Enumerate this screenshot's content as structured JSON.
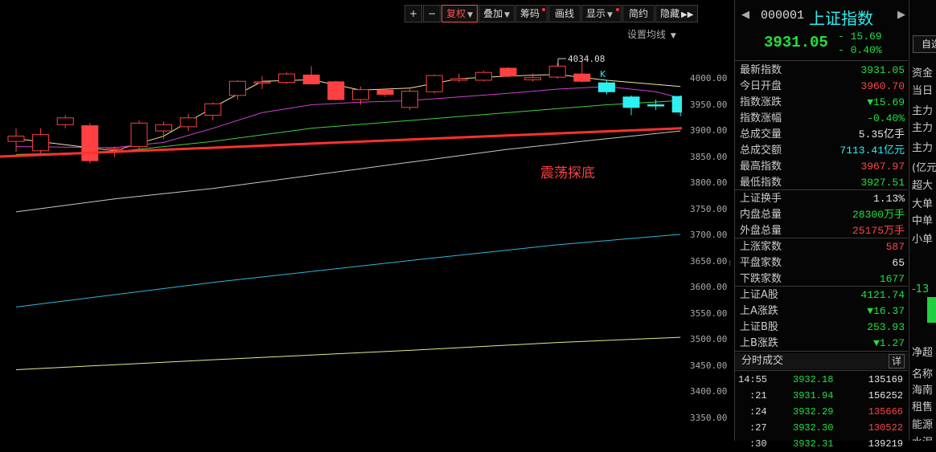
{
  "toolbar": {
    "plus": "+",
    "minus": "−",
    "fuquan": "复权",
    "diejia": "叠加",
    "chouma": "筹码",
    "huaxian": "画线",
    "xianshi": "显示",
    "jianyue": "简约",
    "yincang": "隐藏"
  },
  "chart": {
    "ma_setting": "设置均线",
    "high_marker": "4034.08",
    "k_label": "K",
    "annotation": "震荡探底"
  },
  "chart_data": {
    "type": "candlestick",
    "y_ticks": [
      "4000.00",
      "3950.00",
      "3900.00",
      "3850.00",
      "3800.00",
      "3750.00",
      "3700.00",
      "3650.00",
      "3600.00",
      "3550.00",
      "3500.00",
      "3450.00",
      "3400.00",
      "3350.00"
    ],
    "ylim": [
      3330,
      4060
    ],
    "candles": [
      {
        "o": 3890,
        "h": 3905,
        "l": 3860,
        "c": 3880,
        "dir": "up"
      },
      {
        "o": 3862,
        "h": 3905,
        "l": 3855,
        "c": 3893,
        "dir": "up"
      },
      {
        "o": 3912,
        "h": 3930,
        "l": 3905,
        "c": 3925,
        "dir": "up"
      },
      {
        "o": 3910,
        "h": 3915,
        "l": 3838,
        "c": 3843,
        "dir": "down"
      },
      {
        "o": 3864,
        "h": 3870,
        "l": 3850,
        "c": 3866,
        "dir": "up"
      },
      {
        "o": 3870,
        "h": 3920,
        "l": 3865,
        "c": 3915,
        "dir": "up"
      },
      {
        "o": 3900,
        "h": 3918,
        "l": 3885,
        "c": 3912,
        "dir": "up"
      },
      {
        "o": 3908,
        "h": 3932,
        "l": 3900,
        "c": 3925,
        "dir": "up"
      },
      {
        "o": 3930,
        "h": 3955,
        "l": 3920,
        "c": 3952,
        "dir": "up"
      },
      {
        "o": 3968,
        "h": 3997,
        "l": 3960,
        "c": 3995,
        "dir": "up"
      },
      {
        "o": 3992,
        "h": 4005,
        "l": 3980,
        "c": 3994,
        "dir": "up"
      },
      {
        "o": 3993,
        "h": 4012,
        "l": 3990,
        "c": 4009,
        "dir": "up"
      },
      {
        "o": 4007,
        "h": 4024,
        "l": 3990,
        "c": 3990,
        "dir": "down"
      },
      {
        "o": 3994,
        "h": 3996,
        "l": 3958,
        "c": 3960,
        "dir": "down"
      },
      {
        "o": 3960,
        "h": 3985,
        "l": 3950,
        "c": 3979,
        "dir": "up"
      },
      {
        "o": 3978,
        "h": 3980,
        "l": 3965,
        "c": 3970,
        "dir": "down"
      },
      {
        "o": 3945,
        "h": 3980,
        "l": 3940,
        "c": 3976,
        "dir": "up"
      },
      {
        "o": 3975,
        "h": 4008,
        "l": 3972,
        "c": 4006,
        "dir": "up"
      },
      {
        "o": 3997,
        "h": 4010,
        "l": 3993,
        "c": 4000,
        "dir": "up"
      },
      {
        "o": 3997,
        "h": 4015,
        "l": 3995,
        "c": 4012,
        "dir": "up"
      },
      {
        "o": 4020,
        "h": 4022,
        "l": 4003,
        "c": 4005,
        "dir": "down"
      },
      {
        "o": 3998,
        "h": 4010,
        "l": 3995,
        "c": 4002,
        "dir": "up"
      },
      {
        "o": 4003,
        "h": 4030,
        "l": 4000,
        "c": 4024,
        "dir": "up"
      },
      {
        "o": 4009,
        "h": 4034,
        "l": 3993,
        "c": 3995,
        "dir": "down"
      },
      {
        "o": 3992,
        "h": 3998,
        "l": 3970,
        "c": 3975,
        "dir": "down"
      },
      {
        "o": 3965,
        "h": 3968,
        "l": 3930,
        "c": 3945,
        "dir": "down"
      },
      {
        "o": 3950,
        "h": 3960,
        "l": 3940,
        "c": 3950,
        "dir": "down"
      },
      {
        "o": 3966,
        "h": 3968,
        "l": 3928,
        "c": 3936,
        "dir": "down"
      }
    ],
    "ma_lines": [
      {
        "color": "#e8e8a0",
        "points": [
          [
            0,
            3885
          ],
          [
            4,
            3862
          ],
          [
            6,
            3890
          ],
          [
            8,
            3945
          ],
          [
            10,
            3995
          ],
          [
            12,
            3998
          ],
          [
            14,
            3978
          ],
          [
            16,
            3982
          ],
          [
            18,
            4000
          ],
          [
            20,
            4005
          ],
          [
            22,
            4008
          ],
          [
            24,
            3997
          ],
          [
            27,
            3985
          ]
        ]
      },
      {
        "color": "#d040d0",
        "points": [
          [
            0,
            3870
          ],
          [
            4,
            3868
          ],
          [
            6,
            3878
          ],
          [
            8,
            3905
          ],
          [
            10,
            3935
          ],
          [
            12,
            3950
          ],
          [
            14,
            3955
          ],
          [
            16,
            3958
          ],
          [
            18,
            3965
          ],
          [
            20,
            3972
          ],
          [
            22,
            3980
          ],
          [
            24,
            3985
          ],
          [
            26,
            3975
          ],
          [
            27,
            3963
          ]
        ]
      },
      {
        "color": "#40d040",
        "points": [
          [
            0,
            3855
          ],
          [
            4,
            3860
          ],
          [
            8,
            3880
          ],
          [
            12,
            3905
          ],
          [
            16,
            3920
          ],
          [
            20,
            3935
          ],
          [
            24,
            3950
          ],
          [
            27,
            3958
          ]
        ]
      },
      {
        "color": "#c8c8c8",
        "points": [
          [
            0,
            3745
          ],
          [
            4,
            3770
          ],
          [
            8,
            3790
          ],
          [
            12,
            3815
          ],
          [
            16,
            3840
          ],
          [
            20,
            3865
          ],
          [
            24,
            3885
          ],
          [
            27,
            3900
          ]
        ]
      },
      {
        "color": "#30b8d8",
        "points": [
          [
            0,
            3563
          ],
          [
            8,
            3610
          ],
          [
            16,
            3652
          ],
          [
            22,
            3682
          ],
          [
            27,
            3702
          ]
        ]
      },
      {
        "color": "#e8e890",
        "points": [
          [
            0,
            3443
          ],
          [
            8,
            3462
          ],
          [
            16,
            3480
          ],
          [
            22,
            3495
          ],
          [
            27,
            3505
          ]
        ]
      }
    ]
  },
  "quote": {
    "code": "000001",
    "name": "上证指数",
    "price": "3931.05",
    "change": "- 15.69",
    "pct": "- 0.40%",
    "self_select": "自选"
  },
  "stats": [
    {
      "label": "最新指数",
      "value": "3931.05",
      "color": "green"
    },
    {
      "label": "今日开盘",
      "value": "3960.70",
      "color": "red"
    },
    {
      "label": "指数涨跌",
      "value": "▼15.69",
      "color": "green"
    },
    {
      "label": "指数涨幅",
      "value": "-0.40%",
      "color": "green"
    },
    {
      "label": "总成交量",
      "value": "5.35亿手",
      "color": "white"
    },
    {
      "label": "总成交额",
      "value": "7113.41亿元",
      "color": "cyan"
    },
    {
      "label": "最高指数",
      "value": "3967.97",
      "color": "red"
    },
    {
      "label": "最低指数",
      "value": "3927.51",
      "color": "green"
    },
    {
      "label": "上证换手",
      "value": "1.13%",
      "color": "white"
    },
    {
      "label": "内盘总量",
      "value": "28300万手",
      "color": "green"
    },
    {
      "label": "外盘总量",
      "value": "25175万手",
      "color": "red"
    },
    {
      "label": "上涨家数",
      "value": "587",
      "color": "red"
    },
    {
      "label": "平盘家数",
      "value": "65",
      "color": "white"
    },
    {
      "label": "下跌家数",
      "value": "1677",
      "color": "green"
    },
    {
      "label": "上证A股",
      "value": "4121.74",
      "color": "green"
    },
    {
      "label": "上A涨跌",
      "value": "▼16.37",
      "color": "green"
    },
    {
      "label": "上证B股",
      "value": "253.93",
      "color": "green"
    },
    {
      "label": "上B涨跌",
      "value": "▼1.27",
      "color": "green"
    }
  ],
  "ticks": {
    "title": "分时成交",
    "detail": "详",
    "rows": [
      {
        "time": "14:55",
        "price": "3932.18",
        "vol": "135169",
        "vcolor": "white"
      },
      {
        "time": ":21",
        "price": "3931.94",
        "vol": "156252",
        "vcolor": "white"
      },
      {
        "time": ":24",
        "price": "3932.29",
        "vol": "135666",
        "vcolor": "red"
      },
      {
        "time": ":27",
        "price": "3932.30",
        "vol": "130522",
        "vcolor": "red"
      },
      {
        "time": ":30",
        "price": "3932.31",
        "vol": "139219",
        "vcolor": "white"
      }
    ]
  },
  "far": {
    "items": [
      "资金",
      "当日",
      "主力",
      "主力",
      "主力",
      "(亿元",
      "超大",
      "大单",
      "中单",
      "小单",
      "-13",
      "净超",
      "名称",
      "海南",
      "租售",
      "能源",
      "水泥"
    ]
  }
}
